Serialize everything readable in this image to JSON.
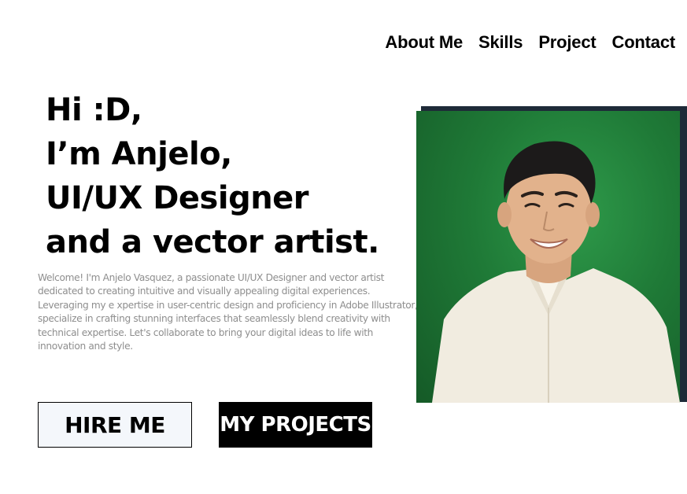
{
  "nav": {
    "items": [
      {
        "label": "About Me"
      },
      {
        "label": "Skills"
      },
      {
        "label": "Project"
      },
      {
        "label": "Contact"
      }
    ]
  },
  "hero": {
    "lines": [
      "Hi :D,",
      "I’m Anjelo,",
      "UI/UX Designer",
      "and a vector artist."
    ],
    "intro": "Welcome! I'm Anjelo Vasquez, a passionate UI/UX Designer and vector artist dedicated to creating intuitive and visually appealing digital experiences. Leveraging my e xpertise in user-centric design and proficiency in Adobe Illustrator, I specialize in crafting stunning interfaces that seamlessly blend creativity with technical expertise. Let's collaborate to bring your digital ideas to life with innovation and style."
  },
  "buttons": {
    "hire_label": "HIRE ME",
    "projects_label": "MY PROJECTS"
  },
  "colors": {
    "photo_background": "#1f7a37",
    "photo_frame": "#1e2a38",
    "hire_bg": "#f4f7fb",
    "projects_bg": "#000000",
    "intro_text": "#8e8e8e"
  }
}
